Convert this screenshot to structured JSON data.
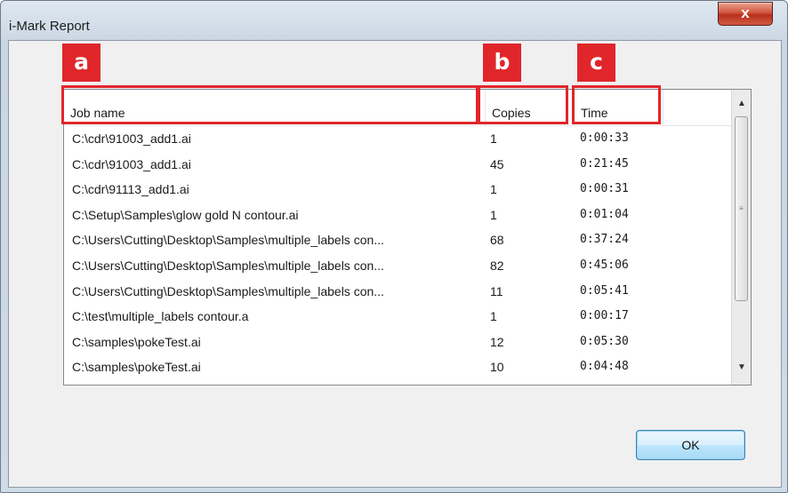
{
  "window": {
    "title": "i-Mark Report",
    "close_label": "x"
  },
  "columns": {
    "job": "Job name",
    "copies": "Copies",
    "time": "Time"
  },
  "rows": [
    {
      "job": "C:\\cdr\\91003_add1.ai",
      "copies": "1",
      "time": "0:00:33"
    },
    {
      "job": "C:\\cdr\\91003_add1.ai",
      "copies": "45",
      "time": "0:21:45"
    },
    {
      "job": "C:\\cdr\\91113_add1.ai",
      "copies": "1",
      "time": "0:00:31"
    },
    {
      "job": "C:\\Setup\\Samples\\glow gold N contour.ai",
      "copies": "1",
      "time": "0:01:04"
    },
    {
      "job": "C:\\Users\\Cutting\\Desktop\\Samples\\multiple_labels con...",
      "copies": "68",
      "time": "0:37:24"
    },
    {
      "job": "C:\\Users\\Cutting\\Desktop\\Samples\\multiple_labels con...",
      "copies": "82",
      "time": "0:45:06"
    },
    {
      "job": "C:\\Users\\Cutting\\Desktop\\Samples\\multiple_labels con...",
      "copies": "11",
      "time": "0:05:41"
    },
    {
      "job": "C:\\test\\multiple_labels contour.a",
      "copies": "1",
      "time": "0:00:17"
    },
    {
      "job": "C:\\samples\\pokeTest.ai",
      "copies": "12",
      "time": "0:05:30"
    },
    {
      "job": "C:\\samples\\pokeTest.ai",
      "copies": "10",
      "time": "0:04:48"
    }
  ],
  "ok_label": "OK",
  "annotations": {
    "a": "a",
    "b": "b",
    "c": "c"
  },
  "colors": {
    "annotation": "#e0262b",
    "close_button": "#c8432a"
  },
  "icons": {
    "scroll_up": "scroll-up-arrow-icon",
    "scroll_down": "scroll-down-arrow-icon",
    "close": "close-icon"
  }
}
